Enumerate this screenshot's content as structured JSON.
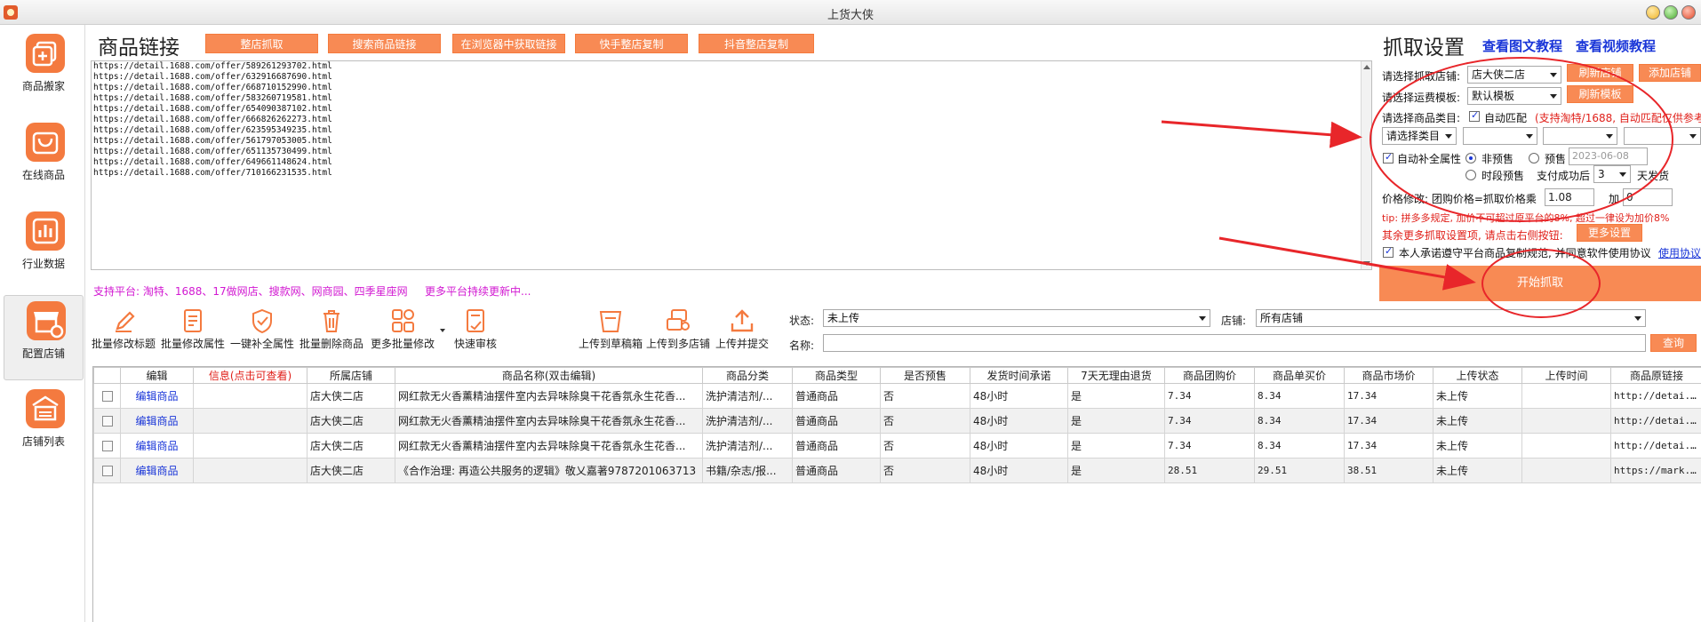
{
  "window": {
    "title": "上货大侠"
  },
  "sidebar": {
    "items": [
      {
        "label": "商品搬家",
        "icon": "plus-window-icon"
      },
      {
        "label": "在线商品",
        "icon": "shopping-bag-icon"
      },
      {
        "label": "行业数据",
        "icon": "bar-chart-icon"
      },
      {
        "label": "配置店铺",
        "icon": "store-gear-icon"
      },
      {
        "label": "店铺列表",
        "icon": "store-list-icon"
      }
    ]
  },
  "links": {
    "title": "商品链接",
    "buttons": [
      "整店抓取",
      "搜索商品链接",
      "在浏览器中获取链接",
      "快手整店复制",
      "抖音整店复制"
    ],
    "urls": [
      "https://detail.1688.com/offer/589261293702.html",
      "https://detail.1688.com/offer/632916687690.html",
      "https://detail.1688.com/offer/668710152990.html",
      "https://detail.1688.com/offer/583260719581.html",
      "https://detail.1688.com/offer/654090387102.html",
      "https://detail.1688.com/offer/666826262273.html",
      "https://detail.1688.com/offer/623595349235.html",
      "https://detail.1688.com/offer/561797053005.html",
      "https://detail.1688.com/offer/651135730499.html",
      "https://detail.1688.com/offer/649661148624.html",
      "https://detail.1688.com/offer/710166231535.html"
    ],
    "platforms": "支持平台: 淘特、1688、17做网店、搜款网、网商园、四季星座网",
    "platforms_more": "更多平台持续更新中..."
  },
  "toolbar": {
    "tools": [
      {
        "label": "批量修改标题",
        "icon": "edit-pencil-icon"
      },
      {
        "label": "批量修改属性",
        "icon": "edit-list-icon"
      },
      {
        "label": "一键补全属性",
        "icon": "complete-shield-icon"
      },
      {
        "label": "批量删除商品",
        "icon": "trash-icon"
      },
      {
        "label": "更多批量修改",
        "icon": "grid-apps-icon"
      },
      {
        "label": "快速审核",
        "icon": "review-check-icon"
      },
      {
        "label": "上传到草稿箱",
        "icon": "draft-box-icon"
      },
      {
        "label": "上传到多店铺",
        "icon": "multi-store-upload-icon"
      },
      {
        "label": "上传并提交",
        "icon": "upload-arrow-icon"
      }
    ]
  },
  "filters": {
    "status_label": "状态:",
    "status_value": "未上传",
    "store_label": "店铺:",
    "store_value": "所有店铺",
    "name_label": "名称:",
    "name_value": "",
    "query_label": "查询"
  },
  "table": {
    "columns": [
      "",
      "编辑",
      "信息(点击可查看)",
      "所属店铺",
      "商品名称(双击编辑)",
      "商品分类",
      "商品类型",
      "是否预售",
      "发货时间承诺",
      "7天无理由退货",
      "商品团购价",
      "商品单买价",
      "商品市场价",
      "上传状态",
      "上传时间",
      "商品原链接"
    ],
    "rows": [
      {
        "edit": "编辑商品",
        "info": "",
        "store": "店大侠二店",
        "name": "网红款无火香薰精油摆件室内去异味除臭干花香氛永生花香...",
        "category": "洗护清洁剂/...",
        "type": "普通商品",
        "presale": "否",
        "ship": "48小时",
        "return7": "是",
        "group_price": "7.34",
        "single_price": "8.34",
        "market_price": "17.34",
        "status": "未上传",
        "time": "",
        "link": "http://detai..."
      },
      {
        "edit": "编辑商品",
        "info": "",
        "store": "店大侠二店",
        "name": "网红款无火香薰精油摆件室内去异味除臭干花香氛永生花香...",
        "category": "洗护清洁剂/...",
        "type": "普通商品",
        "presale": "否",
        "ship": "48小时",
        "return7": "是",
        "group_price": "7.34",
        "single_price": "8.34",
        "market_price": "17.34",
        "status": "未上传",
        "time": "",
        "link": "http://detai..."
      },
      {
        "edit": "编辑商品",
        "info": "",
        "store": "店大侠二店",
        "name": "网红款无火香薰精油摆件室内去异味除臭干花香氛永生花香...",
        "category": "洗护清洁剂/...",
        "type": "普通商品",
        "presale": "否",
        "ship": "48小时",
        "return7": "是",
        "group_price": "7.34",
        "single_price": "8.34",
        "market_price": "17.34",
        "status": "未上传",
        "time": "",
        "link": "http://detai..."
      },
      {
        "edit": "编辑商品",
        "info": "",
        "store": "店大侠二店",
        "name": "《合作治理: 再造公共服务的逻辑》敬乂嘉著9787201063713",
        "category": "书籍/杂志/报...",
        "type": "普通商品",
        "presale": "否",
        "ship": "48小时",
        "return7": "是",
        "group_price": "28.51",
        "single_price": "29.51",
        "market_price": "38.51",
        "status": "未上传",
        "time": "",
        "link": "https://mark..."
      }
    ]
  },
  "settings": {
    "title": "抓取设置",
    "tutorial_text": "查看图文教程",
    "tutorial_video": "查看视频教程",
    "store_label": "请选择抓取店铺:",
    "store_value": "店大侠二店",
    "refresh_store": "刷新店铺",
    "add_store": "添加店铺",
    "shipping_label": "请选择运费模板:",
    "shipping_value": "默认模板",
    "refresh_template": "刷新模板",
    "category_label": "请选择商品类目:",
    "auto_match": "自动匹配",
    "auto_match_note": "(支持淘特/1688, 自动匹配仅供参考",
    "category_select": "请选择类目",
    "auto_attr": "自动补全属性",
    "non_presale": "非预售",
    "presale": "预售",
    "presale_date": "2023-06-08",
    "stage_presale": "时段预售",
    "pay_success": "支付成功后",
    "days_value": "3",
    "days_suffix": "天发货",
    "price_label": "价格修改: 团购价格=抓取价格乘",
    "price_multiplier": "1.08",
    "price_add_label": "加",
    "price_add_value": "0",
    "tip": "tip: 拼多多规定, 加价不可超过原平台的8%, 超过一律设为加价8%",
    "more_label": "其余更多抓取设置项, 请点击右侧按钮:",
    "more_button": "更多设置",
    "agree_text": "本人承诺遵守平台商品复制规范, 并同意软件使用协议",
    "agree_link": "使用协议",
    "start_button": "开始抓取"
  },
  "colors": {
    "accent": "#f88a54",
    "link": "#1a36d8",
    "warning": "#e0201a",
    "platforms": "#d219d2",
    "annotation": "#e8262a"
  }
}
